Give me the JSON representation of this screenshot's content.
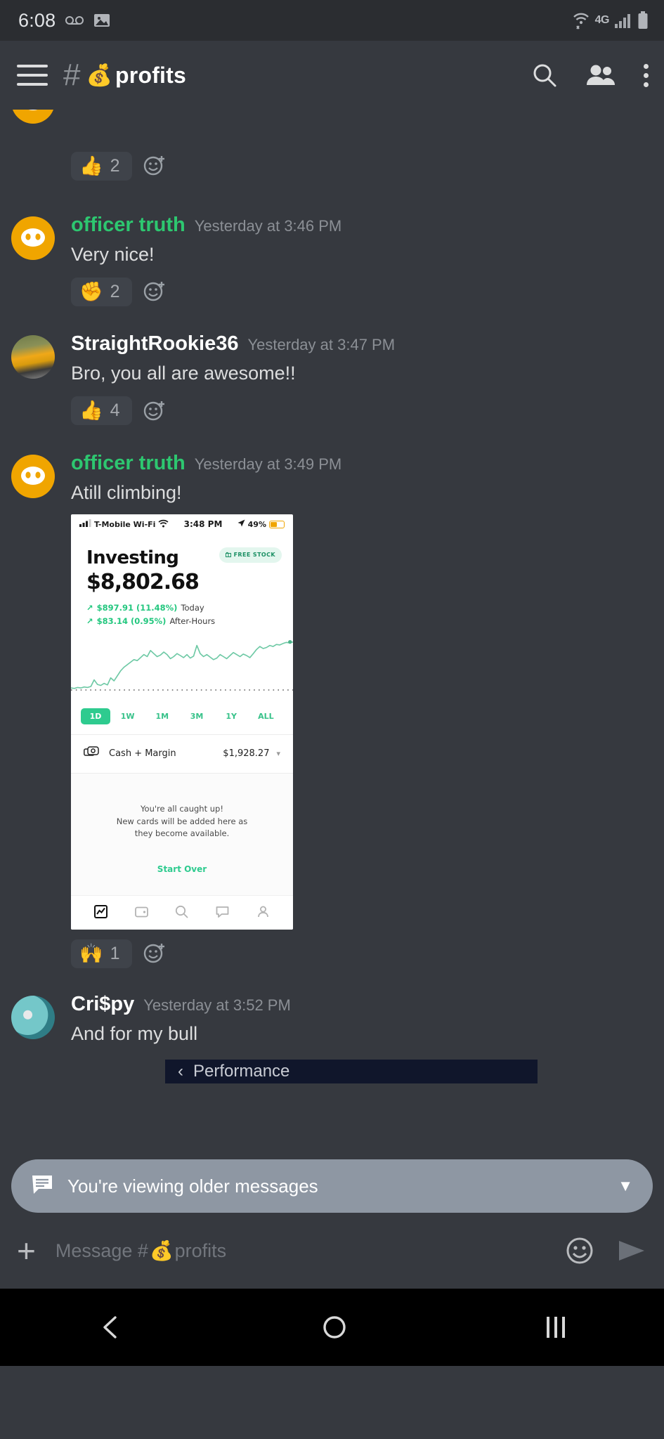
{
  "android_status": {
    "time": "6:08",
    "icons": [
      "voicemail-icon",
      "image-icon"
    ],
    "network_label": "4G",
    "right_icons": [
      "wifi-icon",
      "cellular-signal-icon",
      "battery-icon"
    ]
  },
  "channel_header": {
    "hash": "#",
    "channel_emoji": "💰",
    "channel_name": "profits",
    "actions": [
      "search-icon",
      "members-icon",
      "overflow-menu-icon"
    ],
    "menu_icon": "hamburger-menu-icon"
  },
  "messages": [
    {
      "id": "msg-top-partial",
      "author": "",
      "timestamp": "",
      "text": "",
      "reactions": [
        {
          "emoji": "👍",
          "count": "2"
        }
      ]
    },
    {
      "id": "msg-officer-truth-1",
      "author": "officer truth",
      "author_color": "#2dc770",
      "timestamp": "Yesterday at 3:46 PM",
      "text": "Very nice!",
      "avatar": "discord-logo-avatar",
      "reactions": [
        {
          "emoji": "✊",
          "count": "2"
        }
      ]
    },
    {
      "id": "msg-straightrookie36",
      "author": "StraightRookie36",
      "author_color": "#ffffff",
      "timestamp": "Yesterday at 3:47 PM",
      "text": "Bro, you all are awesome!!",
      "avatar": "motorcycle-photo-avatar",
      "reactions": [
        {
          "emoji": "👍",
          "count": "4"
        }
      ]
    },
    {
      "id": "msg-officer-truth-2",
      "author": "officer truth",
      "author_color": "#2dc770",
      "timestamp": "Yesterday at 3:49 PM",
      "text": "Atill climbing!",
      "avatar": "discord-logo-avatar",
      "reactions": [
        {
          "emoji": "🙌",
          "count": "1"
        }
      ]
    },
    {
      "id": "msg-crispy",
      "author": "Cri$py",
      "author_color": "#ffffff",
      "timestamp": "Yesterday at 3:52 PM",
      "text": "And for my bull",
      "avatar": "rick-and-morty-avatar",
      "reactions": []
    }
  ],
  "attachment_robinhood": {
    "status_bar": {
      "carrier": "T-Mobile Wi-Fi",
      "clock": "3:48 PM",
      "battery_pct": "49%",
      "location_icon": "location-arrow-icon",
      "wifi_icon": "wifi-icon",
      "signal_icon": "cellular-bars-icon"
    },
    "title": "Investing",
    "portfolio_value": "$8,802.68",
    "free_stock_badge": "FREE STOCK",
    "free_stock_icon": "gift-icon",
    "deltas": [
      {
        "arrow": "↗",
        "amount": "$897.91 (11.48%)",
        "label": "Today"
      },
      {
        "arrow": "↗",
        "amount": "$83.14 (0.95%)",
        "label": "After-Hours"
      }
    ],
    "ranges": [
      "1D",
      "1W",
      "1M",
      "3M",
      "1Y",
      "ALL"
    ],
    "active_range": "1D",
    "cash_row": {
      "icon": "cash-stack-icon",
      "label": "Cash + Margin",
      "value": "$1,928.27",
      "chevron": "chevron-down-icon"
    },
    "caught_up": {
      "line1": "You're all caught up!",
      "line2": "New cards will be added here as",
      "line3": "they become available.",
      "action": "Start Over"
    },
    "bottom_nav": [
      {
        "icon": "portfolio-chart-icon",
        "active": true
      },
      {
        "icon": "wallet-icon",
        "active": false
      },
      {
        "icon": "search-icon",
        "active": false
      },
      {
        "icon": "chat-bubble-icon",
        "active": false
      },
      {
        "icon": "account-person-icon",
        "active": false
      }
    ],
    "accent_green": "#2ecb8f",
    "chart": {
      "line_color": "#6ec9a5",
      "baseline_style": "dotted"
    }
  },
  "partial_attachment_below": {
    "back_icon": "chevron-left-icon",
    "label": "Performance"
  },
  "older_banner": {
    "icon": "message-list-icon",
    "text": "You're viewing older messages",
    "chevron": "chevron-down-icon",
    "background": "#8e97a3"
  },
  "composer": {
    "add_icon": "plus-icon",
    "placeholder_prefix": "Message #",
    "placeholder_emoji": "💰",
    "placeholder_channel": "profits",
    "emoji_icon": "emoji-smiley-icon",
    "send_icon": "send-arrow-icon"
  },
  "android_nav": {
    "back": "back-chevron-icon",
    "home": "home-circle-icon",
    "recents": "recents-lines-icon"
  },
  "chart_data": {
    "type": "line",
    "title": "Investing $8,802.68",
    "xlabel": "",
    "ylabel": "",
    "series": [
      {
        "name": "1D portfolio value",
        "values": [
          0.04,
          0.03,
          0.05,
          0.04,
          0.06,
          0.05,
          0.07,
          0.2,
          0.11,
          0.09,
          0.13,
          0.1,
          0.24,
          0.18,
          0.28,
          0.38,
          0.45,
          0.5,
          0.55,
          0.6,
          0.58,
          0.64,
          0.7,
          0.66,
          0.78,
          0.72,
          0.66,
          0.69,
          0.75,
          0.7,
          0.62,
          0.66,
          0.72,
          0.68,
          0.64,
          0.7,
          0.63,
          0.67,
          0.88,
          0.72,
          0.66,
          0.7,
          0.65,
          0.6,
          0.63,
          0.7,
          0.66,
          0.62,
          0.68,
          0.74,
          0.7,
          0.66,
          0.71,
          0.68,
          0.64,
          0.72,
          0.8,
          0.86,
          0.82,
          0.84,
          0.88,
          0.86,
          0.9,
          0.89,
          0.92,
          0.94,
          0.93,
          0.95
        ]
      }
    ],
    "baseline": 0.0,
    "grid": false,
    "legend": "none"
  }
}
